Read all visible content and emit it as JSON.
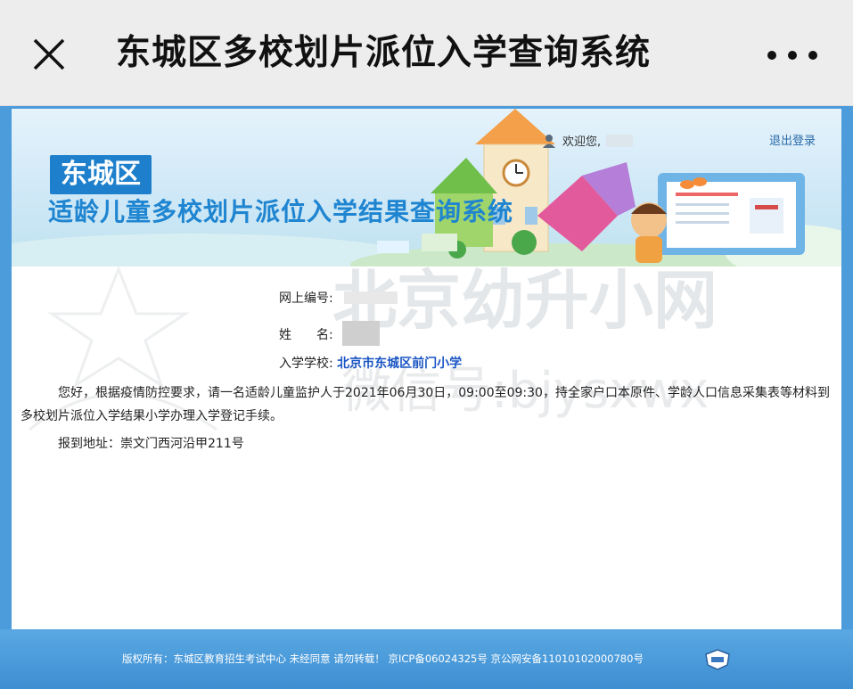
{
  "topbar": {
    "title": "东城区多校划片派位入学查询系统",
    "close_icon": "close-icon",
    "more_icon": "more-icon"
  },
  "banner": {
    "district": "东城区",
    "system_title": "适龄儿童多校划片派位入学结果查询系统",
    "welcome_label": "欢迎您,",
    "logout_label": "退出登录"
  },
  "info": {
    "registration_label": "网上编号:",
    "name_label": "姓　　名:",
    "school_label": "入学学校:",
    "school_value": "北京市东城区前门小学"
  },
  "notice": {
    "text": "您好，根据疫情防控要求，请一名适龄儿童监护人于2021年06月30日，09:00至09:30，持全家户口本原件、学龄人口信息采集表等材料到多校划片派位入学结果小学办理入学登记手续。",
    "address": "报到地址：崇文门西河沿甲211号"
  },
  "watermark": {
    "line1": "北京幼升小网",
    "line2": "微信号:bjysxwx"
  },
  "footer": {
    "text": "版权所有：东城区教育招生考试中心 未经同意 请勿转载！  京ICP备06024325号  京公网安备11010102000780号"
  },
  "colors": {
    "accent": "#1e80cc",
    "frame": "#4c9bdb",
    "school": "#1a55c4"
  }
}
